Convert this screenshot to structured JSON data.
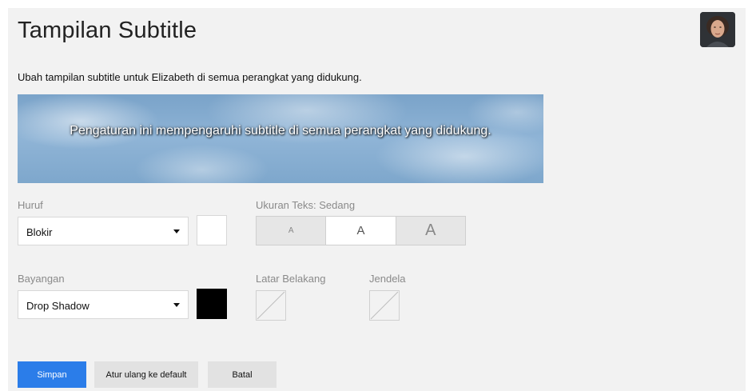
{
  "page": {
    "title": "Tampilan Subtitle",
    "description": "Ubah tampilan subtitle untuk Elizabeth di semua perangkat yang didukung."
  },
  "preview": {
    "text": "Pengaturan ini mempengaruhi subtitle di semua perangkat yang didukung."
  },
  "font": {
    "label": "Huruf",
    "selected": "Blokir",
    "color": "#ffffff"
  },
  "text_size": {
    "label": "Ukuran Teks: Sedang",
    "options": [
      "A",
      "A",
      "A"
    ],
    "selected_index": 1
  },
  "shadow": {
    "label": "Bayangan",
    "selected": "Drop Shadow",
    "color": "#000000"
  },
  "background": {
    "label": "Latar Belakang",
    "icon": "no-color-icon"
  },
  "window": {
    "label": "Jendela",
    "icon": "no-color-icon"
  },
  "buttons": {
    "save": "Simpan",
    "reset": "Atur ulang ke default",
    "cancel": "Batal"
  },
  "colors": {
    "primary": "#2b7de9",
    "panel": "#f2f2f2"
  }
}
